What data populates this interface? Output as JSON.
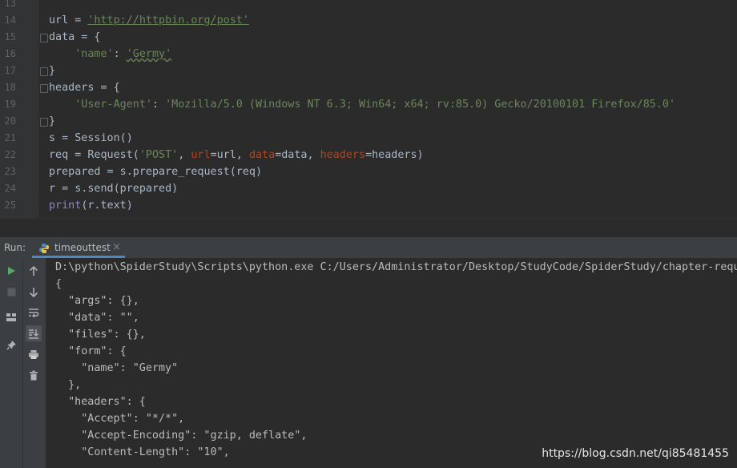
{
  "editor": {
    "line_numbers": [
      "13",
      "14",
      "15",
      "16",
      "17",
      "18",
      "19",
      "20",
      "21",
      "22",
      "23",
      "24",
      "25"
    ],
    "lines": {
      "l14_a": "url = ",
      "l14_str": "'http://httpbin.org/post'",
      "l15": "data = {",
      "l16_indent": "    ",
      "l16_key": "'name'",
      "l16_colon": ": ",
      "l16_val": "'Germy'",
      "l17": "}",
      "l18": "headers = {",
      "l19_indent": "    ",
      "l19_key": "'User-Agent'",
      "l19_colon": ": ",
      "l19_val": "'Mozilla/5.0 (Windows NT 6.3; Win64; x64; rv:85.0) Gecko/20100101 Firefox/85.0'",
      "l20": "}",
      "l21": "s = Session()",
      "l22_a": "req = Request(",
      "l22_post": "'POST'",
      "l22_b": ", ",
      "l22_kw1": "url",
      "l22_c": "=url, ",
      "l22_kw2": "data",
      "l22_d": "=data, ",
      "l22_kw3": "headers",
      "l22_e": "=headers)",
      "l23": "prepared = s.prepare_request(req)",
      "l24": "r = s.send(prepared)",
      "l25_print": "print",
      "l25_rest": "(r.text)"
    }
  },
  "run_panel": {
    "label": "Run:",
    "tab_label": "timeouttest",
    "tab_close": "×"
  },
  "console": {
    "lines": [
      "D:\\python\\SpiderStudy\\Scripts\\python.exe C:/Users/Administrator/Desktop/StudyCode/SpiderStudy/chapter-reque",
      "{",
      "  \"args\": {},",
      "  \"data\": \"\",",
      "  \"files\": {},",
      "  \"form\": {",
      "    \"name\": \"Germy\"",
      "  },",
      "  \"headers\": {",
      "    \"Accept\": \"*/*\",",
      "    \"Accept-Encoding\": \"gzip, deflate\",",
      "    \"Content-Length\": \"10\","
    ]
  },
  "watermark": "https://blog.csdn.net/qi85481455",
  "icons": {
    "run": "run-icon",
    "stop": "stop-icon",
    "layout": "layout-icon",
    "pin": "pin-icon",
    "up": "arrow-up-icon",
    "down": "arrow-down-icon",
    "wrap": "soft-wrap-icon",
    "scroll": "scroll-to-end-icon",
    "print": "print-icon",
    "trash": "trash-icon"
  },
  "colors": {
    "background": "#2b2b2b",
    "string": "#6a8759",
    "keyword_arg": "#aa4926",
    "builtin": "#8888c6",
    "run_green": "#59a869"
  }
}
